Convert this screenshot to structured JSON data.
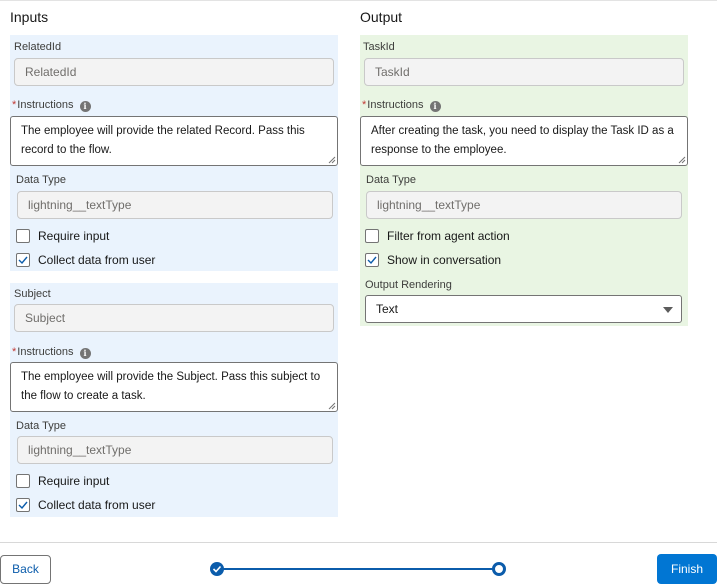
{
  "inputs": {
    "title": "Inputs",
    "blocks": [
      {
        "name_label": "RelatedId",
        "name_value": "RelatedId",
        "instructions_label": "Instructions",
        "instructions_text": "The employee will provide the related Record. Pass this record to the flow.",
        "data_type_label": "Data Type",
        "data_type_value": "lightning__textType",
        "require_input_label": "Require input",
        "require_input_checked": false,
        "collect_label": "Collect data from user",
        "collect_checked": true
      },
      {
        "name_label": "Subject",
        "name_value": "Subject",
        "instructions_label": "Instructions",
        "instructions_text": "The employee will provide the Subject. Pass this subject to the flow to create a task.",
        "data_type_label": "Data Type",
        "data_type_value": "lightning__textType",
        "require_input_label": "Require input",
        "require_input_checked": false,
        "collect_label": "Collect data from user",
        "collect_checked": true
      }
    ]
  },
  "output": {
    "title": "Output",
    "name_label": "TaskId",
    "name_value": "TaskId",
    "instructions_label": "Instructions",
    "instructions_text": "After creating the task, you need to display the Task ID as a response to the employee.",
    "data_type_label": "Data Type",
    "data_type_value": "lightning__textType",
    "filter_label": "Filter from agent action",
    "filter_checked": false,
    "show_label": "Show in conversation",
    "show_checked": true,
    "rendering_label": "Output Rendering",
    "rendering_value": "Text"
  },
  "footer": {
    "back_label": "Back",
    "finish_label": "Finish",
    "steps_total": 2,
    "current_step": 2
  },
  "colors": {
    "input_panel": "#eaf3fd",
    "output_panel": "#e9f5e3",
    "brand": "#0176d3",
    "required": "#c23934"
  }
}
